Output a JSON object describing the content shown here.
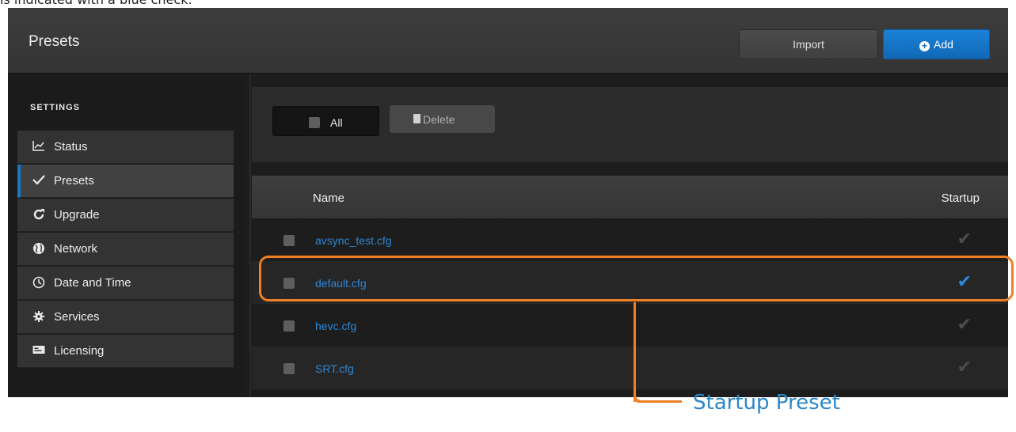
{
  "caption": "is indicated with a blue check.",
  "header": {
    "title": "Presets",
    "import_label": "Import",
    "add_label": "Add"
  },
  "sidebar": {
    "heading": "SETTINGS",
    "items": [
      {
        "label": "Status",
        "icon": "chart-line-icon"
      },
      {
        "label": "Presets",
        "icon": "checkmark-icon",
        "active": true
      },
      {
        "label": "Upgrade",
        "icon": "refresh-icon"
      },
      {
        "label": "Network",
        "icon": "globe-icon"
      },
      {
        "label": "Date and Time",
        "icon": "clock-icon"
      },
      {
        "label": "Services",
        "icon": "gear-icon"
      },
      {
        "label": "Licensing",
        "icon": "license-card-icon"
      }
    ]
  },
  "toolbar": {
    "all_label": "All",
    "delete_label": "Delete"
  },
  "table": {
    "columns": [
      "Name",
      "Startup"
    ],
    "rows": [
      {
        "name": "avsync_test.cfg",
        "startup": false
      },
      {
        "name": "default.cfg",
        "startup": true
      },
      {
        "name": "hevc.cfg",
        "startup": false
      },
      {
        "name": "SRT.cfg",
        "startup": false
      }
    ]
  },
  "annotation": {
    "label": "Startup Preset"
  },
  "colors": {
    "accent_blue": "#1a78c8",
    "highlight_orange": "#f07e22",
    "link_blue": "#2e86d4"
  }
}
